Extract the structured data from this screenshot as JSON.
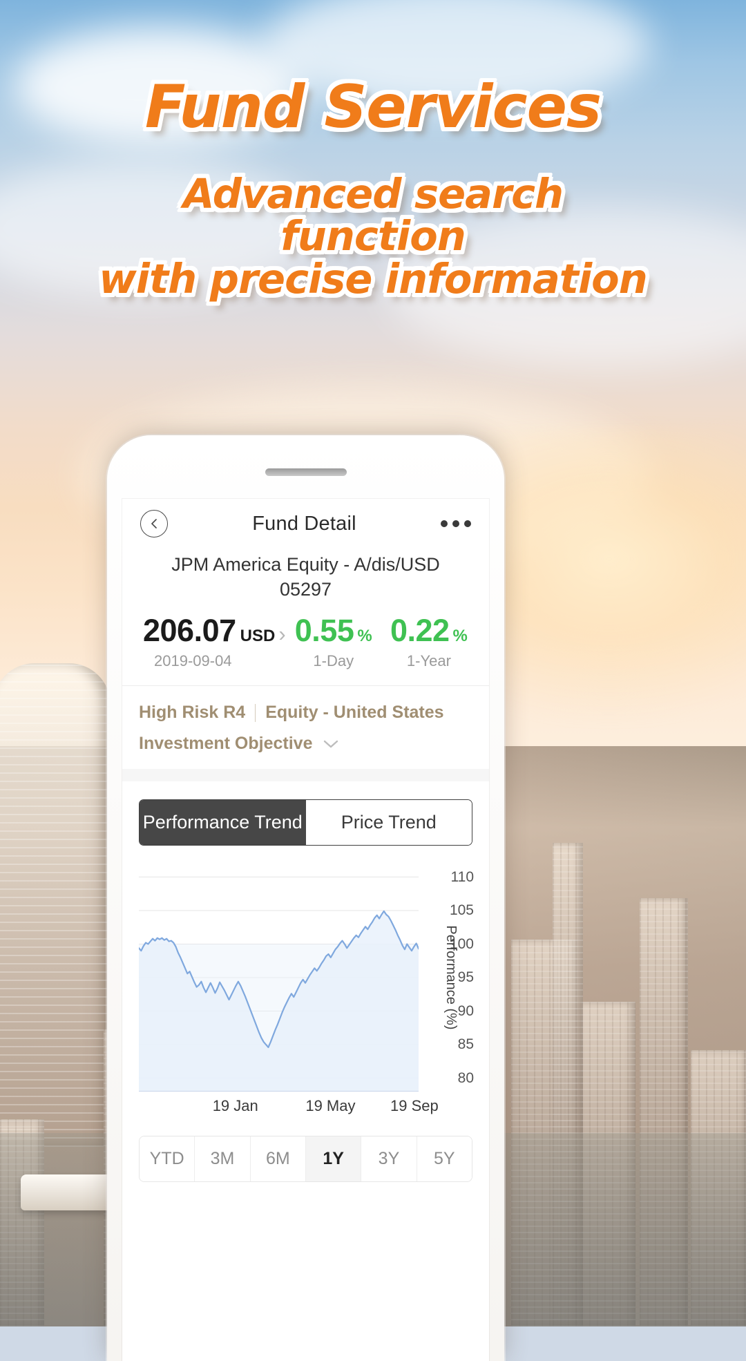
{
  "hero": {
    "title": "Fund Services",
    "subtitle_lines": [
      "Advanced search",
      "function",
      "with precise information"
    ],
    "accent_color": "#F07C1A",
    "outline_color": "#FFFFFF"
  },
  "phone": {
    "screen": {
      "navbar": {
        "back_icon": "chevron-left-circle-icon",
        "title": "Fund Detail",
        "menu_icon": "more-horizontal-icon"
      },
      "fund": {
        "name": "JPM America Equity - A/dis/USD",
        "code": "05297",
        "price": {
          "value": "206.07",
          "currency": "USD",
          "chevron": "›",
          "date": "2019-09-04"
        },
        "metrics": [
          {
            "value": "0.55",
            "unit": "%",
            "label": "1-Day",
            "color": "#3FC152"
          },
          {
            "value": "0.22",
            "unit": "%",
            "label": "1-Year",
            "color": "#3FC152"
          }
        ],
        "risk": "High Risk  R4",
        "category": "Equity - United States",
        "objective_label": "Investment Objective",
        "objective_caret": "⌄"
      },
      "trend_tabs": [
        {
          "label": "Performance Trend",
          "active": true
        },
        {
          "label": "Price Trend",
          "active": false
        }
      ],
      "ranges": [
        {
          "label": "YTD",
          "active": false
        },
        {
          "label": "3M",
          "active": false
        },
        {
          "label": "6M",
          "active": false
        },
        {
          "label": "1Y",
          "active": true
        },
        {
          "label": "3Y",
          "active": false
        },
        {
          "label": "5Y",
          "active": false
        }
      ]
    }
  },
  "chart_data": {
    "type": "line",
    "title": "",
    "xlabel": "",
    "ylabel": "Performance (%)",
    "ylim": [
      78,
      112
    ],
    "yticks": [
      110,
      105,
      100,
      95,
      90,
      85,
      80
    ],
    "grid": true,
    "legend": "none",
    "line_color": "#7FA8DE",
    "fill_color": "#E9F1FB",
    "baseline": 100,
    "x_ticks": [
      {
        "label": "19 Jan",
        "pos": 0.345
      },
      {
        "label": "19 May",
        "pos": 0.685
      },
      {
        "label": "19 Sep",
        "pos": 0.985
      }
    ],
    "x": [
      0,
      1,
      2,
      3,
      4,
      5,
      6,
      7,
      8,
      9,
      10,
      11,
      12,
      13,
      14,
      15,
      16,
      17,
      18,
      19,
      20,
      21,
      22,
      23,
      24,
      25,
      26,
      27,
      28,
      29,
      30,
      31,
      32,
      33,
      34,
      35,
      36,
      37,
      38,
      39,
      40,
      41,
      42,
      43,
      44,
      45,
      46,
      47,
      48,
      49,
      50,
      51,
      52,
      53,
      54,
      55,
      56,
      57,
      58,
      59,
      60,
      61,
      62,
      63,
      64,
      65,
      66,
      67,
      68,
      69,
      70,
      71,
      72,
      73,
      74,
      75,
      76,
      77,
      78,
      79,
      80,
      81,
      82,
      83,
      84,
      85,
      86,
      87,
      88,
      89,
      90,
      91,
      92,
      93,
      94,
      95,
      96,
      97,
      98,
      99,
      100,
      101,
      102,
      103,
      104,
      105,
      106,
      107,
      108,
      109,
      110,
      111,
      112,
      113,
      114,
      115,
      116,
      117,
      118,
      119
    ],
    "values": [
      99.4,
      99.0,
      99.7,
      100.2,
      100.0,
      100.4,
      100.8,
      100.5,
      100.9,
      100.7,
      100.9,
      100.6,
      100.8,
      100.4,
      100.5,
      100.2,
      99.6,
      98.7,
      98.0,
      97.2,
      96.4,
      95.6,
      95.9,
      95.1,
      94.3,
      93.6,
      93.9,
      94.4,
      93.5,
      92.8,
      93.5,
      94.2,
      93.5,
      92.7,
      93.4,
      94.3,
      93.7,
      93.1,
      92.4,
      91.7,
      92.4,
      93.1,
      93.8,
      94.4,
      93.8,
      93.0,
      92.2,
      91.3,
      90.4,
      89.5,
      88.6,
      87.7,
      86.8,
      86.0,
      85.4,
      85.0,
      84.6,
      85.4,
      86.3,
      87.2,
      88.0,
      88.9,
      89.8,
      90.6,
      91.3,
      92.0,
      92.6,
      92.1,
      92.8,
      93.5,
      94.2,
      94.7,
      94.2,
      94.8,
      95.4,
      95.9,
      96.4,
      96.0,
      96.5,
      97.1,
      97.6,
      98.2,
      98.5,
      98.0,
      98.6,
      99.2,
      99.6,
      100.1,
      100.5,
      100.0,
      99.4,
      99.9,
      100.4,
      100.9,
      101.3,
      101.0,
      101.6,
      102.1,
      102.6,
      102.2,
      102.8,
      103.3,
      103.9,
      104.3,
      103.8,
      104.4,
      104.9,
      104.4,
      104.1,
      103.5,
      102.8,
      102.1,
      101.3,
      100.6,
      99.8,
      99.2,
      100.0,
      99.5,
      99.0,
      99.6,
      100.1,
      99.3
    ]
  }
}
